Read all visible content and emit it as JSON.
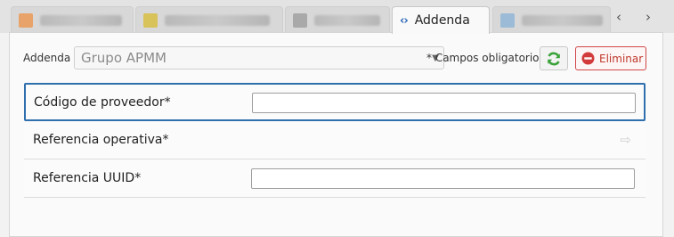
{
  "tabs": [
    {
      "label": "",
      "icon": "orange-document-icon",
      "color": "#e8a36a",
      "blurred": true,
      "active": false
    },
    {
      "label": "",
      "icon": "yellow-document-icon",
      "color": "#d8c25a",
      "blurred": true,
      "active": false
    },
    {
      "label": "",
      "icon": "gray-document-icon",
      "color": "#a9a9a9",
      "blurred": true,
      "active": false
    },
    {
      "label": "Addenda",
      "icon": "code-icon",
      "color": "#2a66b8",
      "blurred": false,
      "active": true
    },
    {
      "label": "",
      "icon": "blue-document-icon",
      "color": "#9bbbd6",
      "blurred": true,
      "active": false
    }
  ],
  "tab_scroll": {
    "prev": "‹",
    "next": "›"
  },
  "toolbar": {
    "addenda_label": "Addenda",
    "addenda_value": "Grupo APMM",
    "required_note": "* Campos obligatorios",
    "delete_label": "Eliminar"
  },
  "fields": [
    {
      "label": "Código de proveedor*",
      "value": "",
      "type": "input",
      "focused": true
    },
    {
      "label": "Referencia operativa*",
      "value": "",
      "type": "readonly-arrow",
      "focused": false
    },
    {
      "label": "Referencia UUID*",
      "value": "",
      "type": "input",
      "focused": false
    }
  ],
  "colors": {
    "accent": "#2f6fad",
    "delete": "#c0392b",
    "refresh": "#3aa23a"
  }
}
